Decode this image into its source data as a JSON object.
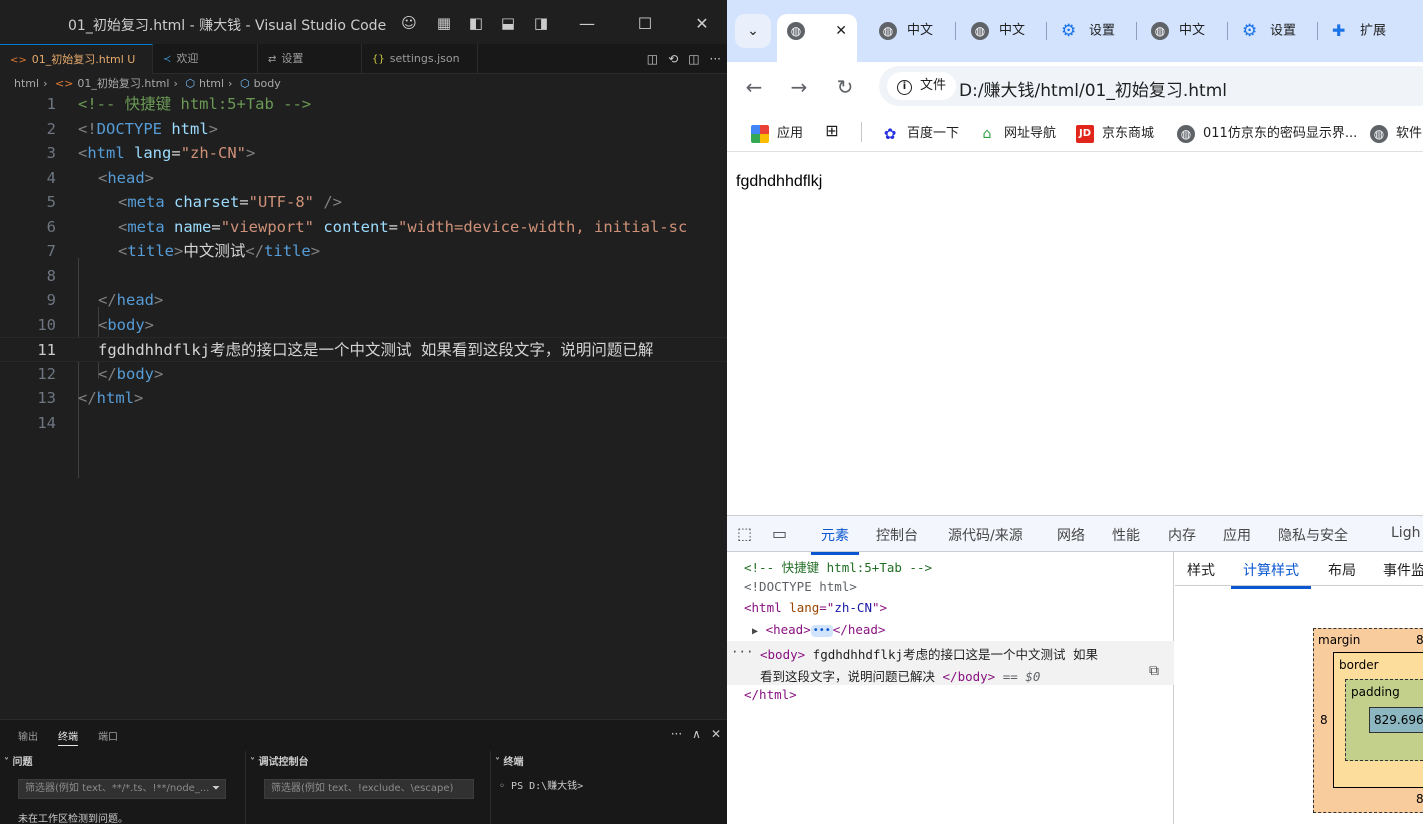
{
  "vscode": {
    "title": "01_初始复习.html - 赚大钱 - Visual Studio Code",
    "tabs": [
      {
        "label": "01_初始复习.html U",
        "icon": "<>"
      },
      {
        "label": "欢迎",
        "icon": "vscode-logo"
      },
      {
        "label": "设置",
        "icon": "settings"
      },
      {
        "label": "settings.json",
        "icon": "{}"
      }
    ],
    "breadcrumb": [
      "html",
      "01_初始复习.html",
      "html",
      "body"
    ],
    "lines": [
      {
        "n": "1"
      },
      {
        "n": "2"
      },
      {
        "n": "3"
      },
      {
        "n": "4"
      },
      {
        "n": "5"
      },
      {
        "n": "6"
      },
      {
        "n": "7"
      },
      {
        "n": "8"
      },
      {
        "n": "9"
      },
      {
        "n": "10"
      },
      {
        "n": "11"
      },
      {
        "n": "12"
      },
      {
        "n": "13"
      },
      {
        "n": "14"
      }
    ],
    "code": {
      "l1": "<!-- 快捷键 html:5+Tab -->",
      "l2_a": "<!",
      "l2_b": "DOCTYPE",
      "l2_c": " html",
      "l2_d": ">",
      "l3_a": "<",
      "l3_b": "html",
      "l3_c": " lang",
      "l3_d": "=",
      "l3_e": "\"zh-CN\"",
      "l3_f": ">",
      "l4_a": "<",
      "l4_b": "head",
      "l4_c": ">",
      "l5_a": "<",
      "l5_b": "meta",
      "l5_c": " charset",
      "l5_d": "=",
      "l5_e": "\"UTF-8\"",
      "l5_f": " />",
      "l6_a": "<",
      "l6_b": "meta",
      "l6_c": " name",
      "l6_d": "=",
      "l6_e": "\"viewport\"",
      "l6_f": " content",
      "l6_g": "=",
      "l6_h": "\"width=device-width, initial-sc",
      "l7_a": "<",
      "l7_b": "title",
      "l7_c": ">",
      "l7_d": "中文测试",
      "l7_e": "</",
      "l7_f": "title",
      "l7_g": ">",
      "l9_a": "</",
      "l9_b": "head",
      "l9_c": ">",
      "l10_a": "<",
      "l10_b": "body",
      "l10_c": ">",
      "l11": "fgdhdhhdflkj考虑的接口这是一个中文测试 如果看到这段文字，说明问题已解",
      "l12_a": "</",
      "l12_b": "body",
      "l12_c": ">",
      "l13_a": "</",
      "l13_b": "html",
      "l13_c": ">"
    },
    "panel": {
      "tabs": [
        "输出",
        "终端",
        "端口"
      ],
      "problems_header": "问题",
      "problems_filter": "筛选器(例如 text、**/*.ts、!**/node_...",
      "problems_message": "未在工作区检测到问题。",
      "debug_header": "调试控制台",
      "debug_filter": "筛选器(例如 text、!exclude、\\escape)",
      "terminal_header": "终端",
      "terminal_line": "PS D:\\赚大钱>"
    }
  },
  "chrome": {
    "tabs": [
      {
        "label": "",
        "icon": "globe-icon",
        "active": true
      },
      {
        "label": "中文",
        "icon": "globe-icon"
      },
      {
        "label": "中文",
        "icon": "globe-icon"
      },
      {
        "label": "设置",
        "icon": "gear-icon"
      },
      {
        "label": "中文",
        "icon": "globe-icon"
      },
      {
        "label": "设置",
        "icon": "gear-icon"
      },
      {
        "label": "扩展",
        "icon": "puzzle-icon"
      }
    ],
    "chip": "文件",
    "url": "D:/赚大钱/html/01_初始复习.html",
    "bookmarks": [
      "应用",
      "百度一下",
      "网址导航",
      "京东商城",
      "011仿京东的密码显示界...",
      "软件"
    ],
    "page_text": "fgdhdhhdflkj",
    "devtools": {
      "tabs": [
        "元素",
        "控制台",
        "源代码/来源",
        "网络",
        "性能",
        "内存",
        "应用",
        "隐私与安全",
        "Ligh"
      ],
      "e1": "<!-- 快捷键 html:5+Tab -->",
      "e2": "<!DOCTYPE html>",
      "e3_a": "<html",
      "e3_b": " lang",
      "e3_c": "=\"",
      "e3_d": "zh-CN",
      "e3_e": "\">",
      "e4_a": "<head>",
      "e4_b": "</head>",
      "e5_a": "<body>",
      "e5_b": " fgdhdhhdflkj考虑的接口这是一个中文测试 如果",
      "e6_a": "看到这段文字，说明问题已解决 ",
      "e6_b": "</body>",
      "e6_c": " == $0",
      "e7": "</html>",
      "side_tabs": [
        "样式",
        "计算样式",
        "布局",
        "事件监"
      ],
      "box": {
        "margin": "margin",
        "margin_val": "8",
        "border": "border",
        "padding": "padding",
        "left_val": "8",
        "content": "829.696",
        "bottom_val": "8"
      }
    }
  }
}
